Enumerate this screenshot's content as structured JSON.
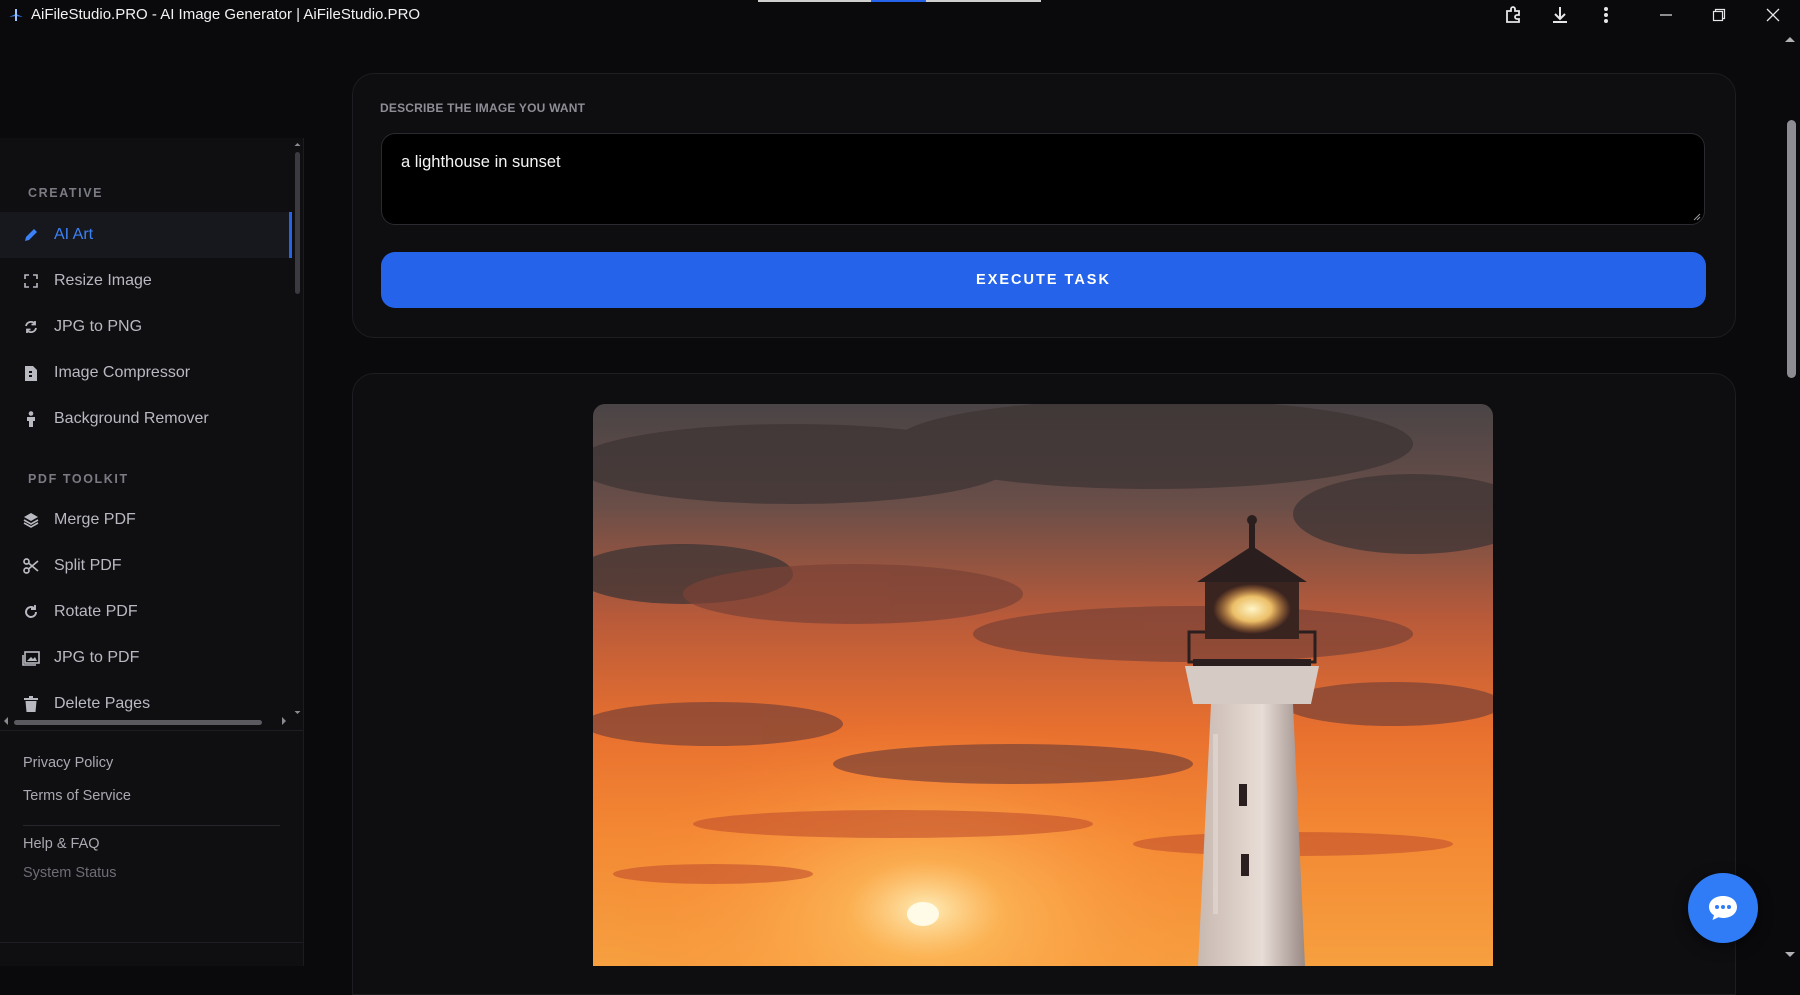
{
  "window": {
    "title": "AiFileStudio.PRO - AI Image Generator | AiFileStudio.PRO",
    "accent": "#2563eb"
  },
  "sidebar": {
    "sections": [
      {
        "label": "CREATIVE",
        "items": [
          {
            "label": "AI Art",
            "icon": "pencil-icon",
            "active": true
          },
          {
            "label": "Resize Image",
            "icon": "expand-icon"
          },
          {
            "label": "JPG to PNG",
            "icon": "sync-icon"
          },
          {
            "label": "Image Compressor",
            "icon": "file-icon"
          },
          {
            "label": "Background Remover",
            "icon": "person-icon"
          }
        ]
      },
      {
        "label": "PDF TOOLKIT",
        "items": [
          {
            "label": "Merge PDF",
            "icon": "layers-icon"
          },
          {
            "label": "Split PDF",
            "icon": "scissors-icon"
          },
          {
            "label": "Rotate PDF",
            "icon": "rotate-icon"
          },
          {
            "label": "JPG to PDF",
            "icon": "images-icon"
          },
          {
            "label": "Delete Pages",
            "icon": "trash-icon"
          }
        ]
      }
    ],
    "footer_links": [
      "Privacy Policy",
      "Terms of Service",
      "Help & FAQ",
      "System Status"
    ]
  },
  "prompt": {
    "label": "DESCRIBE THE IMAGE YOU WANT",
    "value": "a lighthouse in sunset"
  },
  "execute_button": {
    "label": "EXECUTE TASK"
  },
  "result": {
    "icon": "generated-lighthouse-image"
  },
  "chat": {
    "icon": "chat-bubble-icon"
  }
}
